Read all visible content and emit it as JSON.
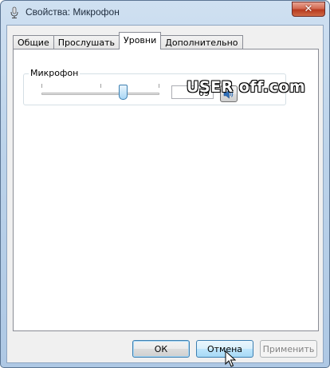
{
  "window": {
    "title": "Свойства: Микрофон",
    "close_glyph": "✕"
  },
  "tabs": [
    {
      "label": "Общие",
      "active": false
    },
    {
      "label": "Прослушать",
      "active": false
    },
    {
      "label": "Уровни",
      "active": true
    },
    {
      "label": "Дополнительно",
      "active": false
    }
  ],
  "levels": {
    "group_label": "Микрофон",
    "slider_value": 69,
    "slider_min": 0,
    "slider_max": 100,
    "value_text": "69",
    "mute_icon": "speaker-icon"
  },
  "watermark": {
    "text": "USER off.com"
  },
  "buttons": {
    "ok": "ОК",
    "cancel": "Отмена",
    "apply": "Применить"
  },
  "colors": {
    "accent": "#3c7fb1",
    "disabled_text": "#838383"
  }
}
